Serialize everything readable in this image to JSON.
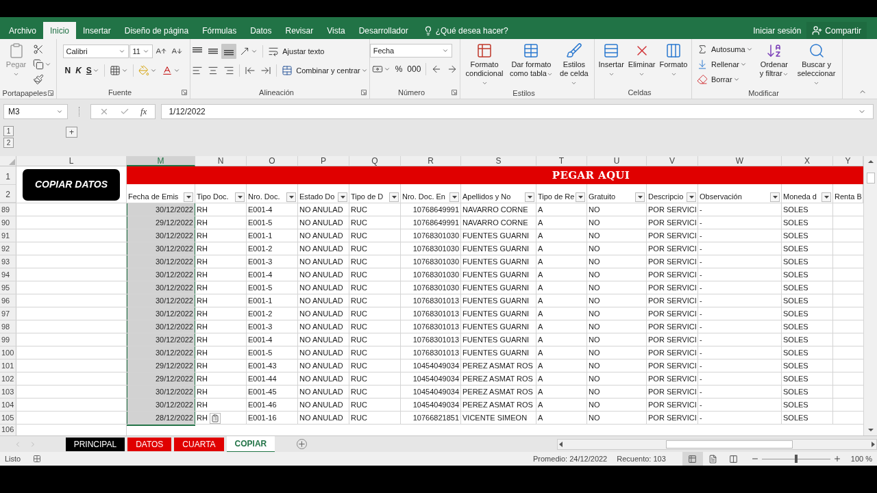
{
  "ribbon_tabs": [
    {
      "label": "Archivo",
      "selected": false
    },
    {
      "label": "Inicio",
      "selected": true
    },
    {
      "label": "Insertar",
      "selected": false
    },
    {
      "label": "Diseño de página",
      "selected": false
    },
    {
      "label": "Fórmulas",
      "selected": false
    },
    {
      "label": "Datos",
      "selected": false
    },
    {
      "label": "Revisar",
      "selected": false
    },
    {
      "label": "Vista",
      "selected": false
    },
    {
      "label": "Desarrollador",
      "selected": false
    }
  ],
  "tell_me": {
    "placeholder": "¿Qué desea hacer?"
  },
  "account": {
    "sign_in": "Iniciar sesión",
    "share": "Compartir"
  },
  "ribbon_groups": [
    {
      "label": "Portapapeles",
      "launcher": true,
      "columns": [
        {
          "kind": "big",
          "label": "Pegar",
          "caret": true,
          "disabled": true
        },
        {
          "kind": "stack",
          "rows": [
            {
              "items": [
                {
                  "kind": "icon",
                  "caret": false
                }
              ]
            },
            {
              "items": [
                {
                  "kind": "icon",
                  "caret": true
                }
              ]
            },
            {
              "items": [
                {
                  "kind": "icon",
                  "caret": false
                }
              ]
            }
          ]
        }
      ]
    },
    {
      "label": "Fuente",
      "launcher": true,
      "columns": [
        {
          "kind": "stack",
          "rows": [
            {
              "items": [
                {
                  "kind": "field",
                  "label": "Calibri"
                },
                {
                  "kind": "field",
                  "label": "11"
                },
                {
                  "kind": "icon",
                  "caret": false
                },
                {
                  "kind": "icon",
                  "caret": false
                }
              ]
            },
            {
              "items": [
                {
                  "kind": "glyph",
                  "label": "N",
                  "caret": false
                },
                {
                  "kind": "glyph",
                  "label": "K",
                  "caret": false
                },
                {
                  "kind": "glyph",
                  "label": "S",
                  "caret": true
                },
                {
                  "kind": "sep"
                },
                {
                  "kind": "icon",
                  "caret": true
                },
                {
                  "kind": "sep"
                },
                {
                  "kind": "icon",
                  "caret": true
                },
                {
                  "kind": "icon",
                  "caret": true
                }
              ]
            }
          ]
        }
      ]
    },
    {
      "label": "Alineación",
      "launcher": true,
      "columns": [
        {
          "kind": "stack",
          "rows": [
            {
              "items": [
                {
                  "kind": "icon",
                  "caret": false,
                  "selected": false
                },
                {
                  "kind": "icon",
                  "caret": false,
                  "selected": false
                },
                {
                  "kind": "icon",
                  "caret": false,
                  "selected": true
                },
                {
                  "kind": "icon",
                  "caret": true
                },
                {
                  "kind": "sep"
                },
                {
                  "kind": "text",
                  "label": "Ajustar texto",
                  "caret": false
                }
              ]
            },
            {
              "items": [
                {
                  "kind": "icon",
                  "caret": false,
                  "selected": false
                },
                {
                  "kind": "icon",
                  "caret": false,
                  "selected": false
                },
                {
                  "kind": "icon",
                  "caret": false,
                  "selected": false
                },
                {
                  "kind": "sep"
                },
                {
                  "kind": "icon",
                  "caret": false
                },
                {
                  "kind": "icon",
                  "caret": false
                },
                {
                  "kind": "sep"
                },
                {
                  "kind": "text",
                  "label": "Combinar y centrar",
                  "caret": true
                }
              ]
            }
          ]
        }
      ]
    },
    {
      "label": "Número",
      "launcher": true,
      "columns": [
        {
          "kind": "stack",
          "rows": [
            {
              "items": [
                {
                  "kind": "field",
                  "label": "Fecha"
                }
              ]
            },
            {
              "items": [
                {
                  "kind": "icon",
                  "caret": true
                },
                {
                  "kind": "glyph",
                  "label": "%",
                  "caret": false
                },
                {
                  "kind": "glyph",
                  "label": "000",
                  "caret": false
                },
                {
                  "kind": "sep"
                },
                {
                  "kind": "icon",
                  "caret": false
                },
                {
                  "kind": "icon",
                  "caret": false
                }
              ]
            }
          ]
        }
      ]
    },
    {
      "label": "Estilos",
      "launcher": false,
      "columns": [
        {
          "kind": "big",
          "label": "Formato condicional",
          "caret": true,
          "disabled": false
        },
        {
          "kind": "big",
          "label": "Dar formato como tabla",
          "caret": true,
          "disabled": false
        },
        {
          "kind": "big",
          "label": "Estilos de celda",
          "caret": true,
          "disabled": false
        }
      ]
    },
    {
      "label": "Celdas",
      "launcher": false,
      "columns": [
        {
          "kind": "big",
          "label": "Insertar",
          "caret": true,
          "disabled": false
        },
        {
          "kind": "big",
          "label": "Eliminar",
          "caret": true,
          "disabled": false
        },
        {
          "kind": "big",
          "label": "Formato",
          "caret": true,
          "disabled": false
        }
      ]
    },
    {
      "label": "Modificar",
      "launcher": false,
      "columns": [
        {
          "kind": "stack",
          "rows": [
            {
              "items": [
                {
                  "kind": "text",
                  "label": "Autosuma",
                  "caret": true
                }
              ]
            },
            {
              "items": [
                {
                  "kind": "text",
                  "label": "Rellenar",
                  "caret": true
                }
              ]
            },
            {
              "items": [
                {
                  "kind": "text",
                  "label": "Borrar",
                  "caret": true
                }
              ]
            }
          ]
        },
        {
          "kind": "big",
          "label": "Ordenar y filtrar",
          "caret": true,
          "disabled": false
        },
        {
          "kind": "big",
          "label": "Buscar y seleccionar",
          "caret": true,
          "disabled": false
        }
      ]
    }
  ],
  "formula_bar": {
    "name_box": "M3",
    "function_symbol": "fx",
    "value": "1/12/2022"
  },
  "outline": {
    "levels": [
      "1",
      "2"
    ],
    "expand": "+"
  },
  "columns": [
    {
      "letter": "L",
      "selected": false
    },
    {
      "letter": "M",
      "selected": true
    },
    {
      "letter": "N",
      "selected": false
    },
    {
      "letter": "O",
      "selected": false
    },
    {
      "letter": "P",
      "selected": false
    },
    {
      "letter": "Q",
      "selected": false
    },
    {
      "letter": "R",
      "selected": false
    },
    {
      "letter": "S",
      "selected": false
    },
    {
      "letter": "T",
      "selected": false
    },
    {
      "letter": "U",
      "selected": false
    },
    {
      "letter": "V",
      "selected": false
    },
    {
      "letter": "W",
      "selected": false
    },
    {
      "letter": "X",
      "selected": false
    },
    {
      "letter": "Y",
      "selected": false
    }
  ],
  "banner_rows": [
    "1",
    "2"
  ],
  "copy_button": "COPIAR DATOS",
  "paste_banner": "PEGAR AQUI",
  "headers": [
    {
      "label": "Fecha de Emis",
      "filter": true
    },
    {
      "label": "Tipo Doc.",
      "filter": true
    },
    {
      "label": "Nro. Doc.",
      "filter": true
    },
    {
      "label": "Estado Do",
      "filter": true
    },
    {
      "label": "Tipo de D",
      "filter": true
    },
    {
      "label": "Nro. Doc. En",
      "filter": true
    },
    {
      "label": "Apellidos y No",
      "filter": true
    },
    {
      "label": "Tipo de Re",
      "filter": true
    },
    {
      "label": "Gratuito",
      "filter": true
    },
    {
      "label": "Descripcio",
      "filter": true
    },
    {
      "label": "Observación",
      "filter": true
    },
    {
      "label": "Moneda d",
      "filter": true
    },
    {
      "label": "Renta B",
      "filter": false
    }
  ],
  "rows": [
    {
      "n": "89",
      "cells": [
        "30/12/2022",
        "RH",
        "E001-4",
        "NO ANULAD",
        "RUC",
        "10768649991",
        "NAVARRO CORNE",
        "A",
        "NO",
        "POR SERVICI",
        "-",
        "SOLES"
      ]
    },
    {
      "n": "90",
      "cells": [
        "29/12/2022",
        "RH",
        "E001-5",
        "NO ANULAD",
        "RUC",
        "10768649991",
        "NAVARRO CORNE",
        "A",
        "NO",
        "POR SERVICI",
        "-",
        "SOLES"
      ]
    },
    {
      "n": "91",
      "cells": [
        "30/12/2022",
        "RH",
        "E001-1",
        "NO ANULAD",
        "RUC",
        "10768301030",
        "FUENTES GUARNI",
        "A",
        "NO",
        "POR SERVICI",
        "-",
        "SOLES"
      ]
    },
    {
      "n": "92",
      "cells": [
        "30/12/2022",
        "RH",
        "E001-2",
        "NO ANULAD",
        "RUC",
        "10768301030",
        "FUENTES GUARNI",
        "A",
        "NO",
        "POR SERVICI",
        "-",
        "SOLES"
      ]
    },
    {
      "n": "93",
      "cells": [
        "30/12/2022",
        "RH",
        "E001-3",
        "NO ANULAD",
        "RUC",
        "10768301030",
        "FUENTES GUARNI",
        "A",
        "NO",
        "POR SERVICI",
        "-",
        "SOLES"
      ]
    },
    {
      "n": "94",
      "cells": [
        "30/12/2022",
        "RH",
        "E001-4",
        "NO ANULAD",
        "RUC",
        "10768301030",
        "FUENTES GUARNI",
        "A",
        "NO",
        "POR SERVICI",
        "-",
        "SOLES"
      ]
    },
    {
      "n": "95",
      "cells": [
        "30/12/2022",
        "RH",
        "E001-5",
        "NO ANULAD",
        "RUC",
        "10768301030",
        "FUENTES GUARNI",
        "A",
        "NO",
        "POR SERVICI",
        "-",
        "SOLES"
      ]
    },
    {
      "n": "96",
      "cells": [
        "30/12/2022",
        "RH",
        "E001-1",
        "NO ANULAD",
        "RUC",
        "10768301013",
        "FUENTES GUARNI",
        "A",
        "NO",
        "POR SERVICI",
        "-",
        "SOLES"
      ]
    },
    {
      "n": "97",
      "cells": [
        "30/12/2022",
        "RH",
        "E001-2",
        "NO ANULAD",
        "RUC",
        "10768301013",
        "FUENTES GUARNI",
        "A",
        "NO",
        "POR SERVICI",
        "-",
        "SOLES"
      ]
    },
    {
      "n": "98",
      "cells": [
        "30/12/2022",
        "RH",
        "E001-3",
        "NO ANULAD",
        "RUC",
        "10768301013",
        "FUENTES GUARNI",
        "A",
        "NO",
        "POR SERVICI",
        "-",
        "SOLES"
      ]
    },
    {
      "n": "99",
      "cells": [
        "30/12/2022",
        "RH",
        "E001-4",
        "NO ANULAD",
        "RUC",
        "10768301013",
        "FUENTES GUARNI",
        "A",
        "NO",
        "POR SERVICI",
        "-",
        "SOLES"
      ]
    },
    {
      "n": "100",
      "cells": [
        "30/12/2022",
        "RH",
        "E001-5",
        "NO ANULAD",
        "RUC",
        "10768301013",
        "FUENTES GUARNI",
        "A",
        "NO",
        "POR SERVICI",
        "-",
        "SOLES"
      ]
    },
    {
      "n": "101",
      "cells": [
        "29/12/2022",
        "RH",
        "E001-43",
        "NO ANULAD",
        "RUC",
        "10454049034",
        "PEREZ ASMAT ROS",
        "A",
        "NO",
        "POR SERVICI",
        "-",
        "SOLES"
      ]
    },
    {
      "n": "102",
      "cells": [
        "29/12/2022",
        "RH",
        "E001-44",
        "NO ANULAD",
        "RUC",
        "10454049034",
        "PEREZ ASMAT ROS",
        "A",
        "NO",
        "POR SERVICI",
        "-",
        "SOLES"
      ]
    },
    {
      "n": "103",
      "cells": [
        "30/12/2022",
        "RH",
        "E001-45",
        "NO ANULAD",
        "RUC",
        "10454049034",
        "PEREZ ASMAT ROS",
        "A",
        "NO",
        "POR SERVICI",
        "-",
        "SOLES"
      ]
    },
    {
      "n": "104",
      "cells": [
        "30/12/2022",
        "RH",
        "E001-46",
        "NO ANULAD",
        "RUC",
        "10454049034",
        "PEREZ ASMAT ROS",
        "A",
        "NO",
        "POR SERVICI",
        "-",
        "SOLES"
      ]
    },
    {
      "n": "105",
      "cells": [
        "28/12/2022",
        "RH",
        "E001-16",
        "NO ANULAD",
        "RUC",
        "10766821851",
        "VICENTE SIMEON",
        "A",
        "NO",
        "POR SERVICI",
        "-",
        "SOLES"
      ]
    }
  ],
  "empty_row": "106",
  "sheet_tabs": [
    {
      "label": "PRINCIPAL",
      "color": "#000000",
      "selected": false
    },
    {
      "label": "DATOS",
      "color": "#e00000",
      "selected": false
    },
    {
      "label": "CUARTA",
      "color": "#e00000",
      "selected": false
    },
    {
      "label": "COPIAR",
      "color": "#217346",
      "selected": true
    }
  ],
  "status_bar": {
    "mode": "Listo",
    "average": "Promedio: 24/12/2022",
    "count": "Recuento: 103",
    "views": [
      {
        "selected": true
      },
      {
        "selected": false
      },
      {
        "selected": false
      }
    ],
    "zoom": {
      "level": 0.5,
      "reading": "100 %"
    }
  }
}
